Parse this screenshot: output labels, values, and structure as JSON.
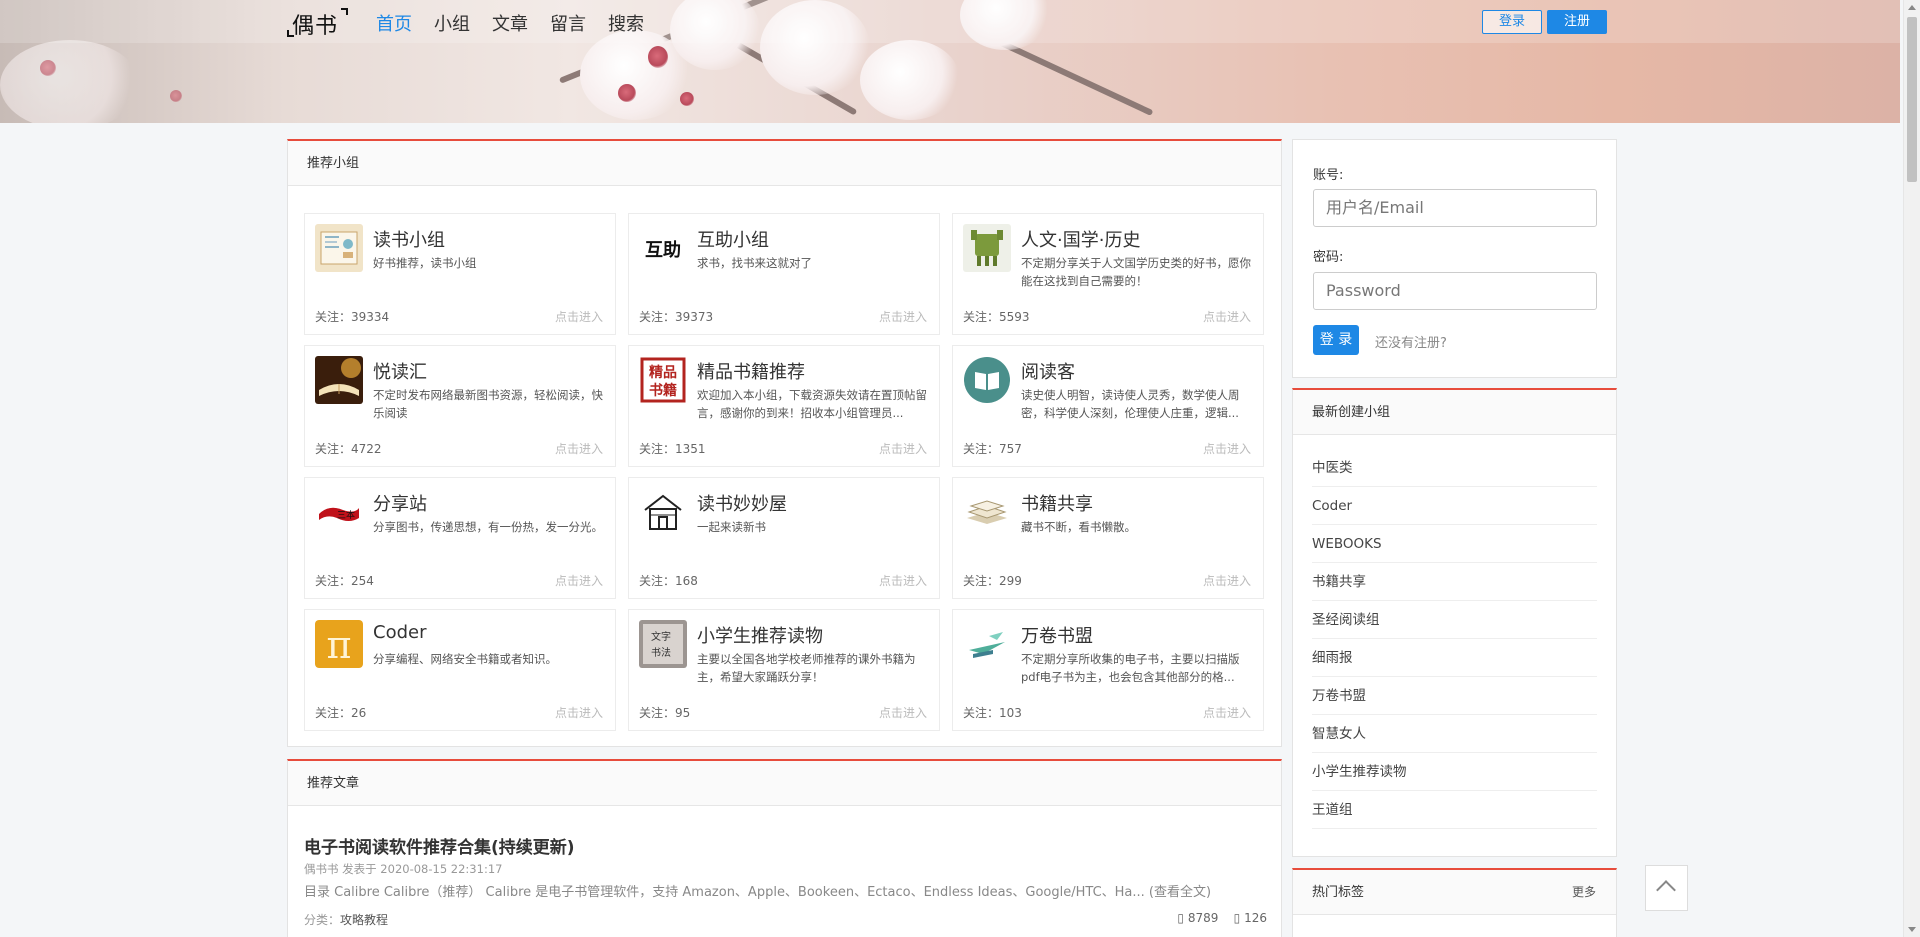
{
  "header": {
    "logo": "偶书",
    "nav": [
      "首页",
      "小组",
      "文章",
      "留言",
      "搜索"
    ],
    "active_nav": 0,
    "login_label": "登录",
    "register_label": "注册"
  },
  "recommended_groups": {
    "title": "推荐小组",
    "follow_prefix": "关注：",
    "enter_label": "点击进入",
    "items": [
      {
        "name": "读书小组",
        "desc": "好书推荐，读书小组",
        "follows": "39334",
        "icon": "book-illustration-icon"
      },
      {
        "name": "互助小组",
        "desc": "求书，找书来这就对了",
        "follows": "39373",
        "icon": "huzhu-calligraphy-icon"
      },
      {
        "name": "人文·国学·历史",
        "desc": "不定期分享关于人文国学历史类的好书，愿你能在这找到自己需要的！",
        "follows": "5593",
        "icon": "bronze-ding-icon"
      },
      {
        "name": "悦读汇",
        "desc": "不定时发布网络最新图书资源，轻松阅读，快乐阅读",
        "follows": "4722",
        "icon": "open-book-photo-icon"
      },
      {
        "name": "精品书籍推荐",
        "desc": "欢迎加入本小组，下载资源失效请在置顶帖留言，感谢你的到来！招收本小组管理员...",
        "follows": "1351",
        "icon": "jingpin-shuji-seal-icon"
      },
      {
        "name": "阅读客",
        "desc": "读史使人明智，读诗使人灵秀，数学使人周密，科学使人深刻，伦理使人庄重，逻辑...",
        "follows": "757",
        "icon": "teal-book-icon"
      },
      {
        "name": "分享站",
        "desc": "分享图书，传递思想，有一份热，发一分光。",
        "follows": "254",
        "icon": "red-brush-icon"
      },
      {
        "name": "读书妙妙屋",
        "desc": "一起来读新书",
        "follows": "168",
        "icon": "house-icon"
      },
      {
        "name": "书籍共享",
        "desc": "藏书不断，看书懒散。",
        "follows": "299",
        "icon": "book-stack-icon"
      },
      {
        "name": "Coder",
        "desc": "分享编程、网络安全书籍或者知识。",
        "follows": "26",
        "icon": "pi-icon"
      },
      {
        "name": "小学生推荐读物",
        "desc": "主要以全国各地学校老师推荐的课外书籍为主，希望大家踊跃分享！",
        "follows": "95",
        "icon": "calligraphy-scroll-icon"
      },
      {
        "name": "万卷书盟",
        "desc": "不定期分享所收集的电子书，主要以扫描版pdf电子书为主，也会包含其他部分的格...",
        "follows": "103",
        "icon": "paper-plane-books-icon"
      }
    ]
  },
  "recommended_articles": {
    "title": "推荐文章",
    "items": [
      {
        "title": "电子书阅读软件推荐合集(持续更新)",
        "meta": "偶书书 发表于 2020-08-15 22:31:17",
        "summary": "目录 Calibre   Calibre（推荐） Calibre 是电子书管理软件，支持 Amazon、Apple、Bookeen、Ectaco、Endless Ideas、Google/HTC、Ha... (查看全文)",
        "category_label": "分类：",
        "category": "攻略教程",
        "views": "8789",
        "comments": "126"
      }
    ]
  },
  "login_form": {
    "account_label": "账号:",
    "account_placeholder": "用户名/Email",
    "password_label": "密码:",
    "password_placeholder": "Password",
    "submit_label": "登 录",
    "no_register_link": "还没有注册?"
  },
  "newest_groups": {
    "title": "最新创建小组",
    "items": [
      "中医类",
      "Coder",
      "WEBOOKS",
      "书籍共享",
      "圣经阅读组",
      "细雨报",
      "万卷书盟",
      "智慧女人",
      "小学生推荐读物",
      "王道组"
    ]
  },
  "hot_tags": {
    "title": "热门标签",
    "more": "更多"
  },
  "colors": {
    "accent": "#1e88e5",
    "panel_top_border": "#e74c3c"
  }
}
